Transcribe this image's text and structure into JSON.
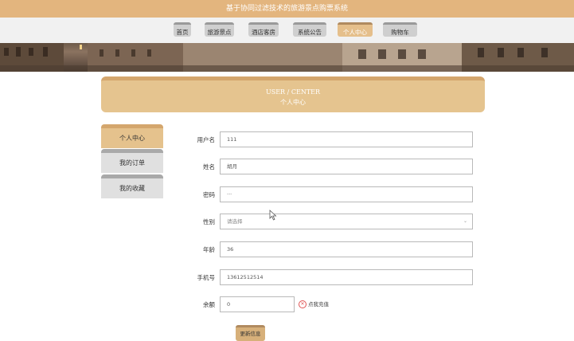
{
  "app": {
    "title": "基于协同过滤技术的旅游景点购票系统"
  },
  "nav": {
    "items": [
      {
        "label": "首页"
      },
      {
        "label": "旅游景点"
      },
      {
        "label": "酒店客房"
      },
      {
        "label": "系统公告"
      },
      {
        "label": "个人中心",
        "active": true
      },
      {
        "label": "购物车"
      }
    ]
  },
  "header": {
    "en": "USER / CENTER",
    "cn": "个人中心"
  },
  "sidebar": {
    "items": [
      {
        "label": "个人中心",
        "active": true
      },
      {
        "label": "我的订单"
      },
      {
        "label": "我的收藏"
      }
    ]
  },
  "form": {
    "username": {
      "label": "用户名",
      "value": "111"
    },
    "name": {
      "label": "姓名",
      "value": "胡月"
    },
    "password": {
      "label": "密码",
      "value": "···"
    },
    "gender": {
      "label": "性别",
      "placeholder": "请选择"
    },
    "age": {
      "label": "年龄",
      "value": "36"
    },
    "phone": {
      "label": "手机号",
      "value": "13612512514"
    },
    "balance": {
      "label": "余额",
      "value": "0",
      "recharge_label": "点我充值"
    },
    "submit_label": "更新信息"
  },
  "colors": {
    "accent": "#e5c28d",
    "topbar": "#e3b57e"
  }
}
